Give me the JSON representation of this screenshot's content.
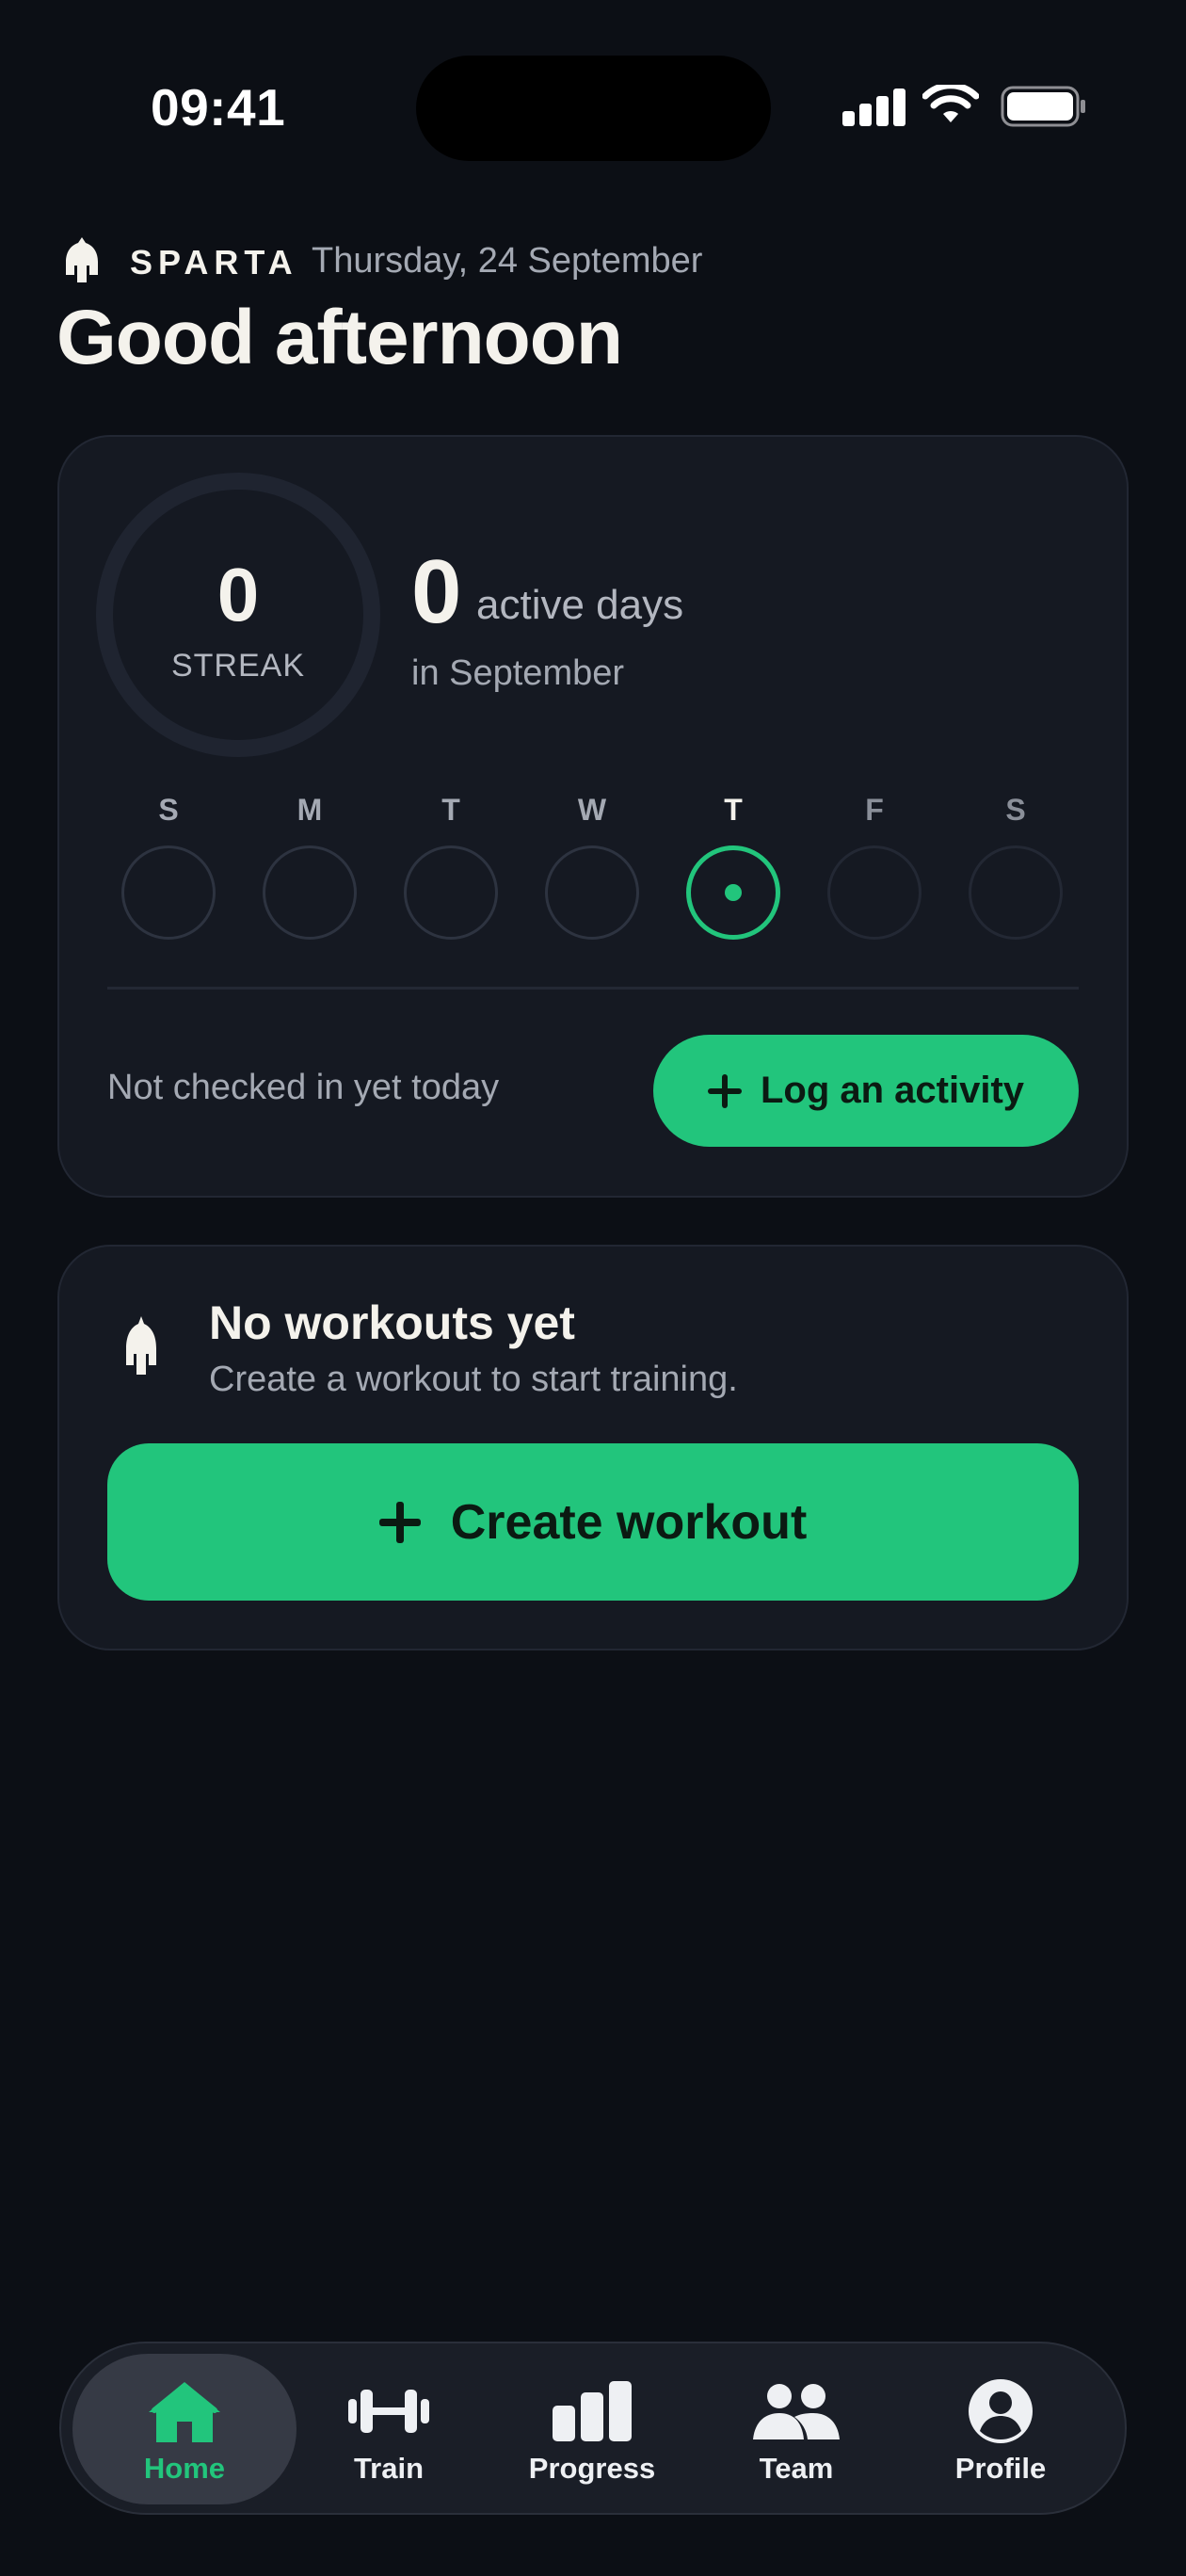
{
  "status_bar": {
    "time": "09:41"
  },
  "header": {
    "brand": "SPARTA",
    "date": "Thursday, 24 September",
    "greeting": "Good afternoon"
  },
  "streak_card": {
    "streak_value": "0",
    "streak_label": "STREAK",
    "active_days_value": "0",
    "active_days_label": "active days",
    "active_days_period": "in September",
    "week": [
      {
        "letter": "S",
        "state": "past"
      },
      {
        "letter": "M",
        "state": "past"
      },
      {
        "letter": "T",
        "state": "past"
      },
      {
        "letter": "W",
        "state": "past"
      },
      {
        "letter": "T",
        "state": "today"
      },
      {
        "letter": "F",
        "state": "future"
      },
      {
        "letter": "S",
        "state": "future"
      }
    ],
    "checkin_status": "Not checked in yet today",
    "log_button": "Log an activity"
  },
  "workouts_card": {
    "title": "No workouts yet",
    "subtitle": "Create a workout to start training.",
    "create_button": "Create workout"
  },
  "tabbar": {
    "items": [
      {
        "label": "Home",
        "icon": "home-icon",
        "active": true
      },
      {
        "label": "Train",
        "icon": "dumbbell-icon",
        "active": false
      },
      {
        "label": "Progress",
        "icon": "bar-chart-icon",
        "active": false
      },
      {
        "label": "Team",
        "icon": "people-icon",
        "active": false
      },
      {
        "label": "Profile",
        "icon": "profile-icon",
        "active": false
      }
    ]
  },
  "colors": {
    "background": "#0c0f15",
    "card": "#151922",
    "accent": "#22c57c",
    "text_primary": "#f4f2ec",
    "text_secondary": "#a4a9b3"
  }
}
